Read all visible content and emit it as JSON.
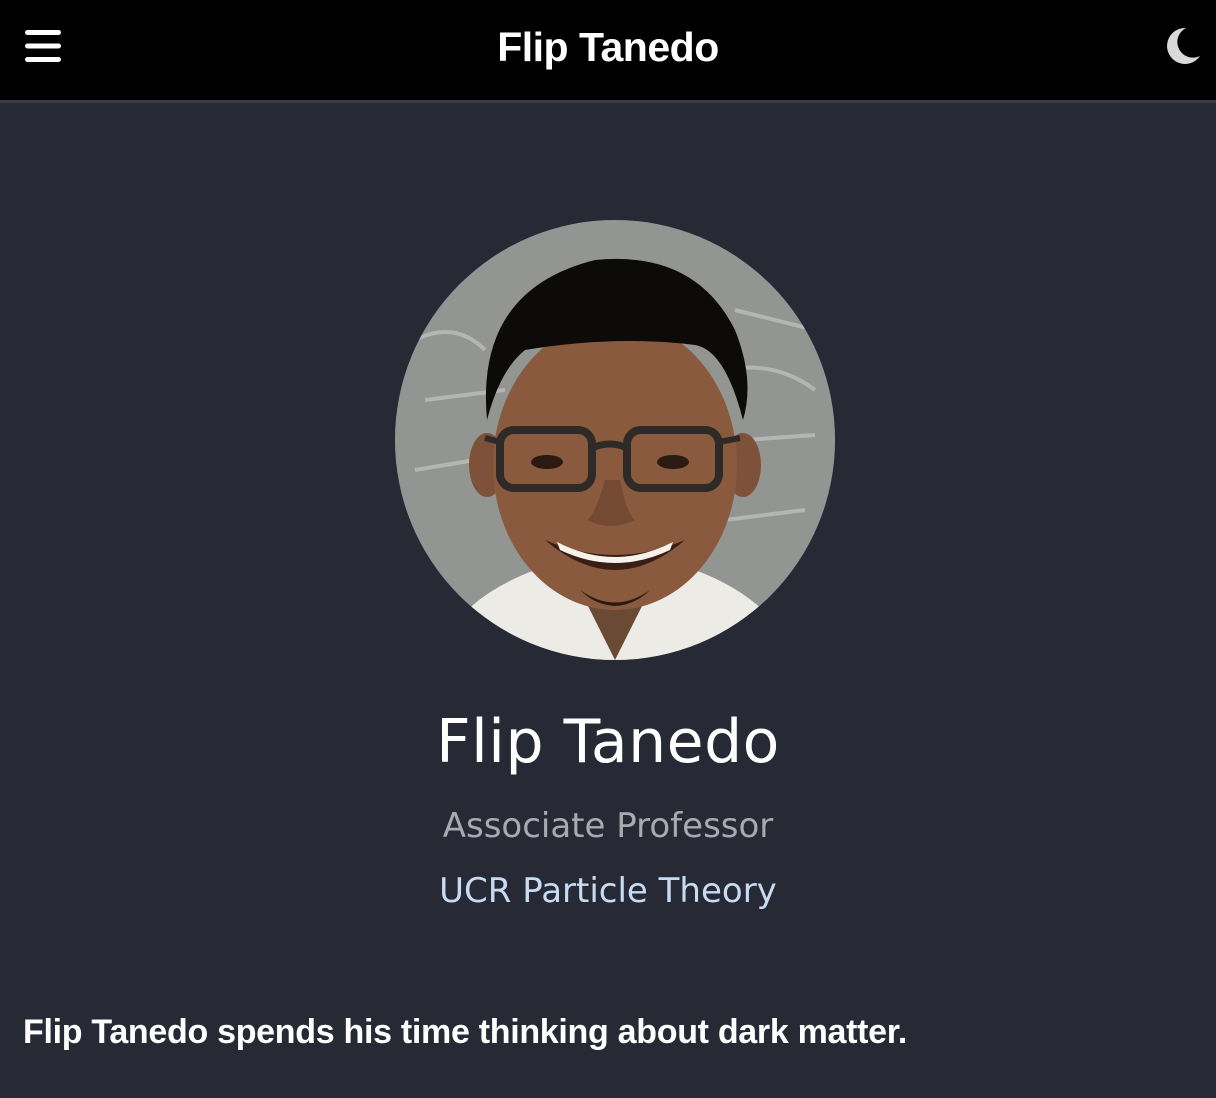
{
  "header": {
    "site_title": "Flip Tanedo",
    "menu_icon": "hamburger-menu-icon",
    "theme_icon": "moon-icon"
  },
  "profile": {
    "name": "Flip Tanedo",
    "role": "Associate Professor",
    "organization": "UCR Particle Theory",
    "bio": "Flip Tanedo spends his time thinking about dark matter."
  },
  "colors": {
    "background": "#272935",
    "topbar": "#000000",
    "text": "#ffffff",
    "muted": "#a9aab0",
    "link": "#c7dcf3"
  }
}
